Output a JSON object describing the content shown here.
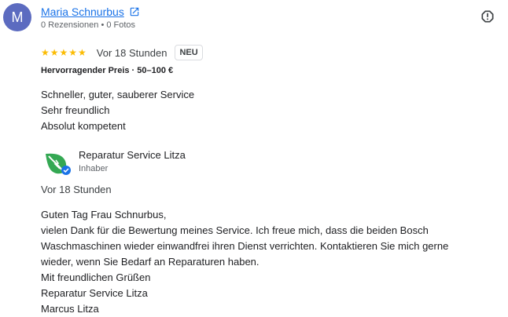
{
  "review": {
    "avatar_letter": "M",
    "author_name": "Maria Schnurbus",
    "author_meta": "0 Rezensionen • 0 Fotos",
    "stars": "★★★★★",
    "rating": 5,
    "time": "Vor 18 Stunden",
    "badge": "NEU",
    "price": "Hervorragender Preis · 50–100 €",
    "text_lines": [
      "Schneller, guter, sauberer Service",
      "Sehr freundlich",
      "Absolut kompetent"
    ]
  },
  "owner_response": {
    "name": "Reparatur Service Litza",
    "role": "Inhaber",
    "time": "Vor 18 Stunden",
    "text_lines": [
      "Guten Tag Frau Schnurbus,",
      "vielen Dank für die Bewertung meines Service. Ich freue mich, dass die beiden Bosch",
      "Waschmaschinen wieder einwandfrei ihren Dienst verrichten. Kontaktieren Sie mich gerne",
      "wieder, wenn Sie Bedarf an Reparaturen haben.",
      "Mit freundlichen Grüßen",
      "Reparatur Service Litza",
      "Marcus Litza"
    ]
  },
  "icons": {
    "external_link": "external-link-icon",
    "report": "report-icon",
    "verified": "verified-badge-icon",
    "logo": "leaf-logo"
  },
  "colors": {
    "link": "#1a73e8",
    "star": "#fbbc04",
    "avatar": "#5c6bc0",
    "logo_green": "#34a853"
  }
}
